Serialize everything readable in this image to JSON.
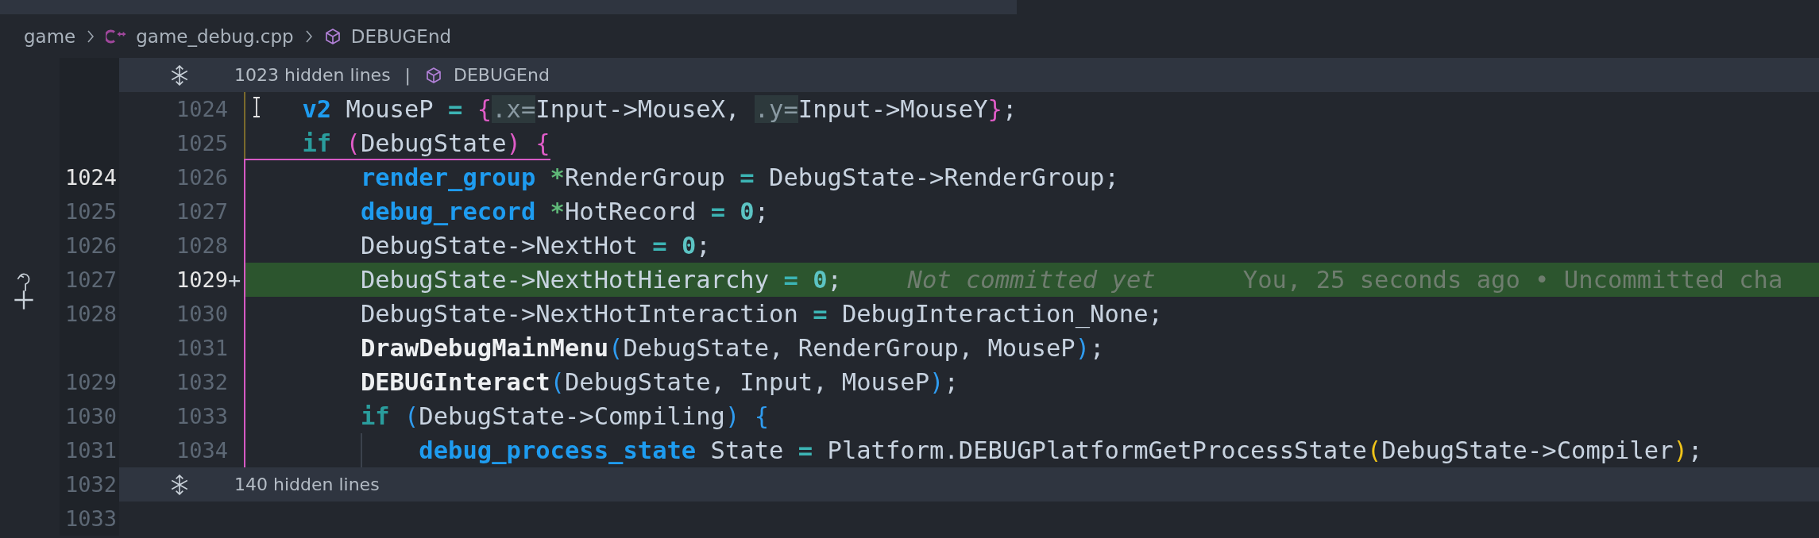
{
  "breadcrumb": [
    {
      "kind": "folder",
      "label": "game"
    },
    {
      "kind": "cpp-file",
      "label": "game_debug.cpp"
    },
    {
      "kind": "symbol",
      "label": "DEBUGEnd"
    }
  ],
  "top_fold": {
    "text": "1023 hidden lines",
    "separator": "|",
    "symbol": "DEBUGEnd"
  },
  "lines": [
    {
      "number": "1024",
      "added": false,
      "tokens": [
        {
          "kind": "type",
          "text": "v2"
        },
        {
          "kind": "plain",
          "text": " MouseP "
        },
        {
          "kind": "op",
          "text": "= "
        },
        {
          "kind": "bracketA",
          "text": "{"
        },
        {
          "kind": "hint",
          "text": ".x="
        },
        {
          "kind": "plain",
          "text": "Input->MouseX, "
        },
        {
          "kind": "hint",
          "text": ".y="
        },
        {
          "kind": "plain",
          "text": "Input->MouseY"
        },
        {
          "kind": "bracketA",
          "text": "}"
        },
        {
          "kind": "plain",
          "text": ";"
        }
      ]
    },
    {
      "number": "1025",
      "added": false,
      "tokens": [
        {
          "kind": "keyword",
          "text": "if "
        },
        {
          "kind": "bracketA",
          "text": "("
        },
        {
          "kind": "plain",
          "text": "DebugState"
        },
        {
          "kind": "bracketA",
          "text": ")"
        },
        {
          "kind": "bracketA",
          "text": " {"
        }
      ],
      "children": [
        {
          "number": "1026",
          "old_number": "1024",
          "old_active": true,
          "added": false,
          "tokens": [
            {
              "kind": "type",
              "text": "render_group"
            },
            {
              "kind": "star",
              "text": " *"
            },
            {
              "kind": "plain",
              "text": "RenderGroup "
            },
            {
              "kind": "op",
              "text": "="
            },
            {
              "kind": "plain",
              "text": " DebugState->RenderGroup;"
            }
          ]
        },
        {
          "number": "1027",
          "old_number": "1025",
          "old_active": false,
          "added": false,
          "tokens": [
            {
              "kind": "type",
              "text": "debug_record"
            },
            {
              "kind": "star",
              "text": " *"
            },
            {
              "kind": "plain",
              "text": "HotRecord "
            },
            {
              "kind": "op",
              "text": "= "
            },
            {
              "kind": "num",
              "text": "0"
            },
            {
              "kind": "plain",
              "text": ";"
            }
          ]
        },
        {
          "number": "1028",
          "old_number": "1026",
          "old_active": false,
          "added": false,
          "tokens": [
            {
              "kind": "plain",
              "text": "DebugState->NextHot "
            },
            {
              "kind": "op",
              "text": "= "
            },
            {
              "kind": "num",
              "text": "0"
            },
            {
              "kind": "plain",
              "text": ";"
            }
          ]
        },
        {
          "number": "1029",
          "old_number": "1027",
          "old_active": false,
          "added": true,
          "gutter_mark": "+",
          "tokens": [
            {
              "kind": "plain",
              "text": "DebugState->NextHotHierarchy "
            },
            {
              "kind": "op",
              "text": "= "
            },
            {
              "kind": "num",
              "text": "0"
            },
            {
              "kind": "plain",
              "text": ";"
            }
          ],
          "blame": [
            {
              "kind": "message",
              "text": "Not committed yet"
            },
            {
              "kind": "detail",
              "text": "You, 25 seconds ago • Uncommitted cha"
            }
          ]
        },
        {
          "number": "1030",
          "old_number": "1028",
          "old_active": false,
          "added": false,
          "tokens": [
            {
              "kind": "plain",
              "text": "DebugState->NextHotInteraction "
            },
            {
              "kind": "op",
              "text": "="
            },
            {
              "kind": "plain",
              "text": " DebugInteraction_None;"
            }
          ]
        },
        {
          "number": "1031",
          "added": false,
          "tokens": [
            {
              "kind": "fn",
              "text": "DrawDebugMainMenu"
            },
            {
              "kind": "bracketB",
              "text": "("
            },
            {
              "kind": "plain",
              "text": "DebugState, RenderGroup, MouseP"
            },
            {
              "kind": "bracketB",
              "text": ")"
            },
            {
              "kind": "plain",
              "text": ";"
            }
          ]
        },
        {
          "number": "1032",
          "old_number": "1029",
          "old_active": false,
          "added": false,
          "tokens": [
            {
              "kind": "fn",
              "text": "DEBUGInteract"
            },
            {
              "kind": "bracketB",
              "text": "("
            },
            {
              "kind": "plain",
              "text": "DebugState, Input, MouseP"
            },
            {
              "kind": "bracketB",
              "text": ")"
            },
            {
              "kind": "plain",
              "text": ";"
            }
          ]
        },
        {
          "number": "1033",
          "old_number": "1030",
          "old_active": false,
          "added": false,
          "tokens": [
            {
              "kind": "keyword",
              "text": "if "
            },
            {
              "kind": "bracketB",
              "text": "("
            },
            {
              "kind": "plain",
              "text": "DebugState->Compiling"
            },
            {
              "kind": "bracketB",
              "text": ")"
            },
            {
              "kind": "bracketB",
              "text": " {"
            }
          ],
          "children": [
            {
              "number": "1034",
              "old_number": "1031",
              "old_active": false,
              "added": false,
              "tokens": [
                {
                  "kind": "type",
                  "text": "debug_process_state"
                },
                {
                  "kind": "plain",
                  "text": " State "
                },
                {
                  "kind": "op",
                  "text": "="
                },
                {
                  "kind": "plain",
                  "text": " Platform.DEBUGPlatformGetProcessState"
                },
                {
                  "kind": "bracketC",
                  "text": "("
                },
                {
                  "kind": "plain",
                  "text": "DebugState->Compiler"
                },
                {
                  "kind": "bracketC",
                  "text": ")"
                },
                {
                  "kind": "plain",
                  "text": ";"
                }
              ]
            }
          ]
        }
      ]
    }
  ],
  "bottom_fold": {
    "text": "140 hidden lines",
    "old_number": "1032"
  },
  "trailing_old_numbers": [
    "1033"
  ]
}
